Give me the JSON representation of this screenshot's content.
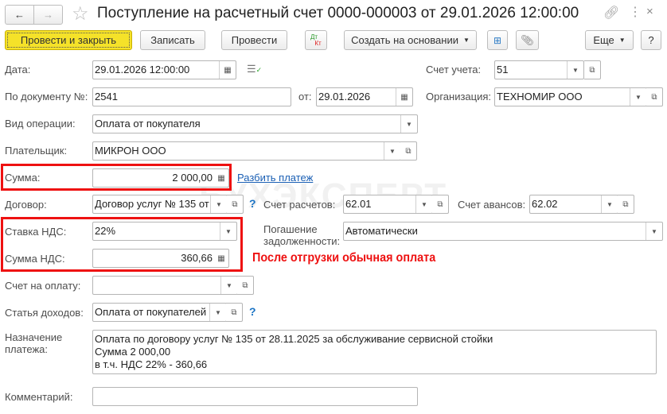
{
  "title": "Поступление на расчетный счет 0000-000003 от 29.01.2026 12:00:00",
  "watermark": "БУХЭКСПЕРТ",
  "toolbar": {
    "post_close": "Провести и закрыть",
    "save": "Записать",
    "post": "Провести",
    "dt": "Дт",
    "kt": "Кт",
    "create_based": "Создать на основании",
    "more": "Еще",
    "help": "?"
  },
  "fields": {
    "date_label": "Дата:",
    "date": "29.01.2026 12:00:00",
    "account_label": "Счет учета:",
    "account": "51",
    "docnum_label": "По документу №:",
    "docnum": "2541",
    "from_label": "от:",
    "from_date": "29.01.2026",
    "org_label": "Организация:",
    "org": "ТЕХНОМИР ООО",
    "op_label": "Вид операции:",
    "op": "Оплата от покупателя",
    "payer_label": "Плательщик:",
    "payer": "МИКРОН ООО",
    "sum_label": "Сумма:",
    "sum": "2 000,00",
    "split_link": "Разбить платеж",
    "contract_label": "Договор:",
    "contract": "Договор услуг № 135 от",
    "settle_label": "Счет расчетов:",
    "settle": "62.01",
    "adv_label": "Счет авансов:",
    "adv": "62.02",
    "vat_rate_label": "Ставка НДС:",
    "vat_rate": "22%",
    "repay_label_1": "Погашение",
    "repay_label_2": "задолженности:",
    "repay": "Автоматически",
    "vat_sum_label": "Сумма НДС:",
    "vat_sum": "360,66",
    "invoice_label": "Счет на оплату:",
    "invoice": "",
    "income_label": "Статья доходов:",
    "income": "Оплата от покупателей",
    "purpose_label_1": "Назначение",
    "purpose_label_2": "платежа:",
    "purpose_1": "Оплата по договору услуг № 135 от 28.11.2025 за обслуживание сервисной стойки",
    "purpose_2": "Сумма 2 000,00",
    "purpose_3": "в т.ч. НДС 22% - 360,66",
    "comment_label": "Комментарий:",
    "comment": ""
  },
  "annotation": "После отгрузки обычная оплата",
  "colors": {
    "primary": "#f5e229",
    "annotation": "#ee1111",
    "link": "#1a5fb4"
  }
}
